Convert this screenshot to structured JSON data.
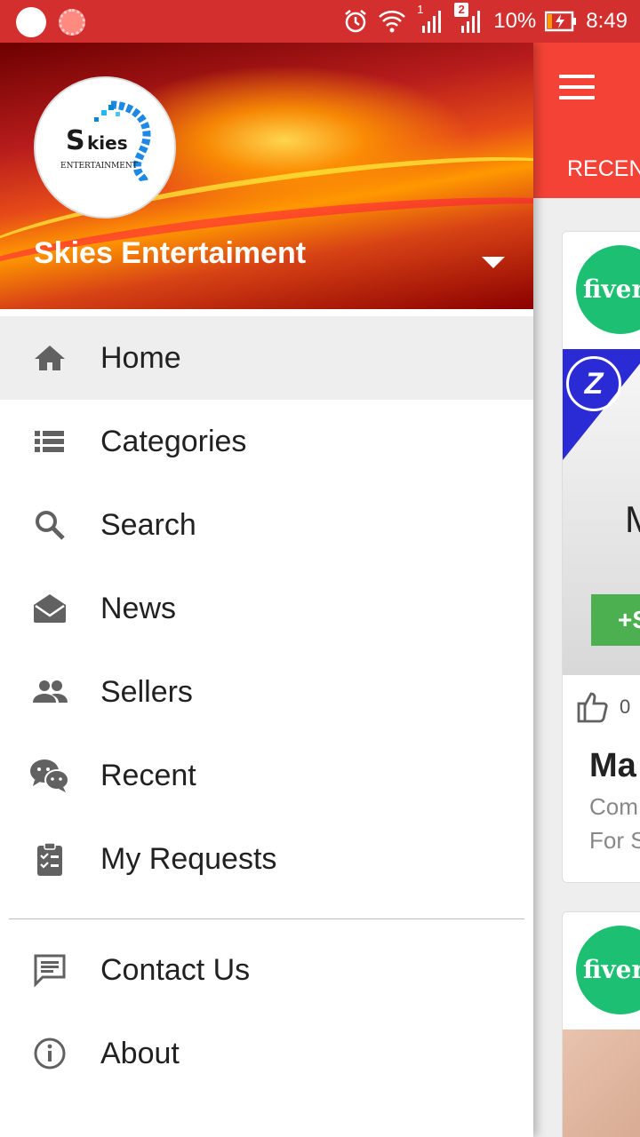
{
  "status_bar": {
    "battery": "10%",
    "time": "8:49",
    "sim1": "1",
    "notification_count": "2"
  },
  "drawer": {
    "account_name": "Skies Entertaiment",
    "logo_text": "kies",
    "logo_subtext": "ENTERTAINMENT",
    "items": [
      {
        "label": "Home",
        "icon": "home-icon",
        "active": true
      },
      {
        "label": "Categories",
        "icon": "list-icon"
      },
      {
        "label": "Search",
        "icon": "search-icon"
      },
      {
        "label": "News",
        "icon": "mail-open-icon"
      },
      {
        "label": "Sellers",
        "icon": "people-icon"
      },
      {
        "label": "Recent",
        "icon": "chat-bubbles-icon"
      },
      {
        "label": "My Requests",
        "icon": "clipboard-check-icon"
      }
    ],
    "secondary_items": [
      {
        "label": "Contact Us",
        "icon": "message-icon"
      },
      {
        "label": "About",
        "icon": "info-icon"
      }
    ]
  },
  "background_app": {
    "tab_label": "RECEN",
    "card1": {
      "badge_text": "fiver",
      "image_letter": "M",
      "button_text": "+S",
      "likes": "0",
      "title": "Ma",
      "subtitle_line1": "Com",
      "subtitle_line2": "For S"
    },
    "card2": {
      "badge_text": "fiver"
    }
  },
  "colors": {
    "status_bar": "#d32f2f",
    "app_bar": "#f44336",
    "icon_gray": "#616161",
    "active_bg": "#eeeeee",
    "fiverr_green": "#1dbf73"
  }
}
